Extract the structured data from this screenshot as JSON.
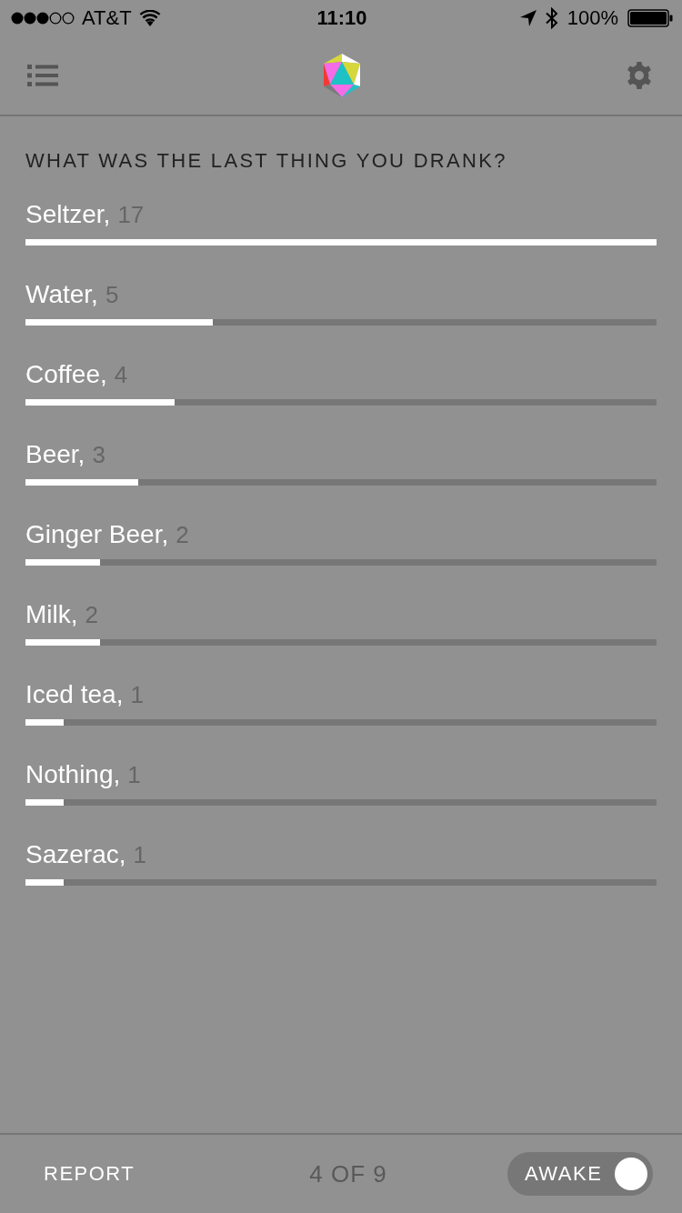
{
  "status_bar": {
    "carrier": "AT&T",
    "time": "11:10",
    "battery": "100%"
  },
  "question": {
    "title": "WHAT WAS THE LAST THING YOU DRANK?"
  },
  "options": [
    {
      "label": "Seltzer,",
      "count": "17",
      "level": 1
    },
    {
      "label": "Water,",
      "count": "5",
      "level": 0.297
    },
    {
      "label": "Coffee,",
      "count": "4",
      "level": 0.236
    },
    {
      "label": "Beer,",
      "count": "3",
      "level": 0.179
    },
    {
      "label": "Ginger Beer,",
      "count": "2",
      "level": 0.118
    },
    {
      "label": "Milk,",
      "count": "2",
      "level": 0.118
    },
    {
      "label": "Iced tea,",
      "count": "1",
      "level": 0.06
    },
    {
      "label": "Nothing,",
      "count": "1",
      "level": 0.06
    },
    {
      "label": "Sazerac,",
      "count": "1",
      "level": 0.06
    }
  ],
  "footer": {
    "report": "REPORT",
    "page": "4 OF 9",
    "awake": {
      "label": "AWAKE",
      "on": true
    }
  }
}
